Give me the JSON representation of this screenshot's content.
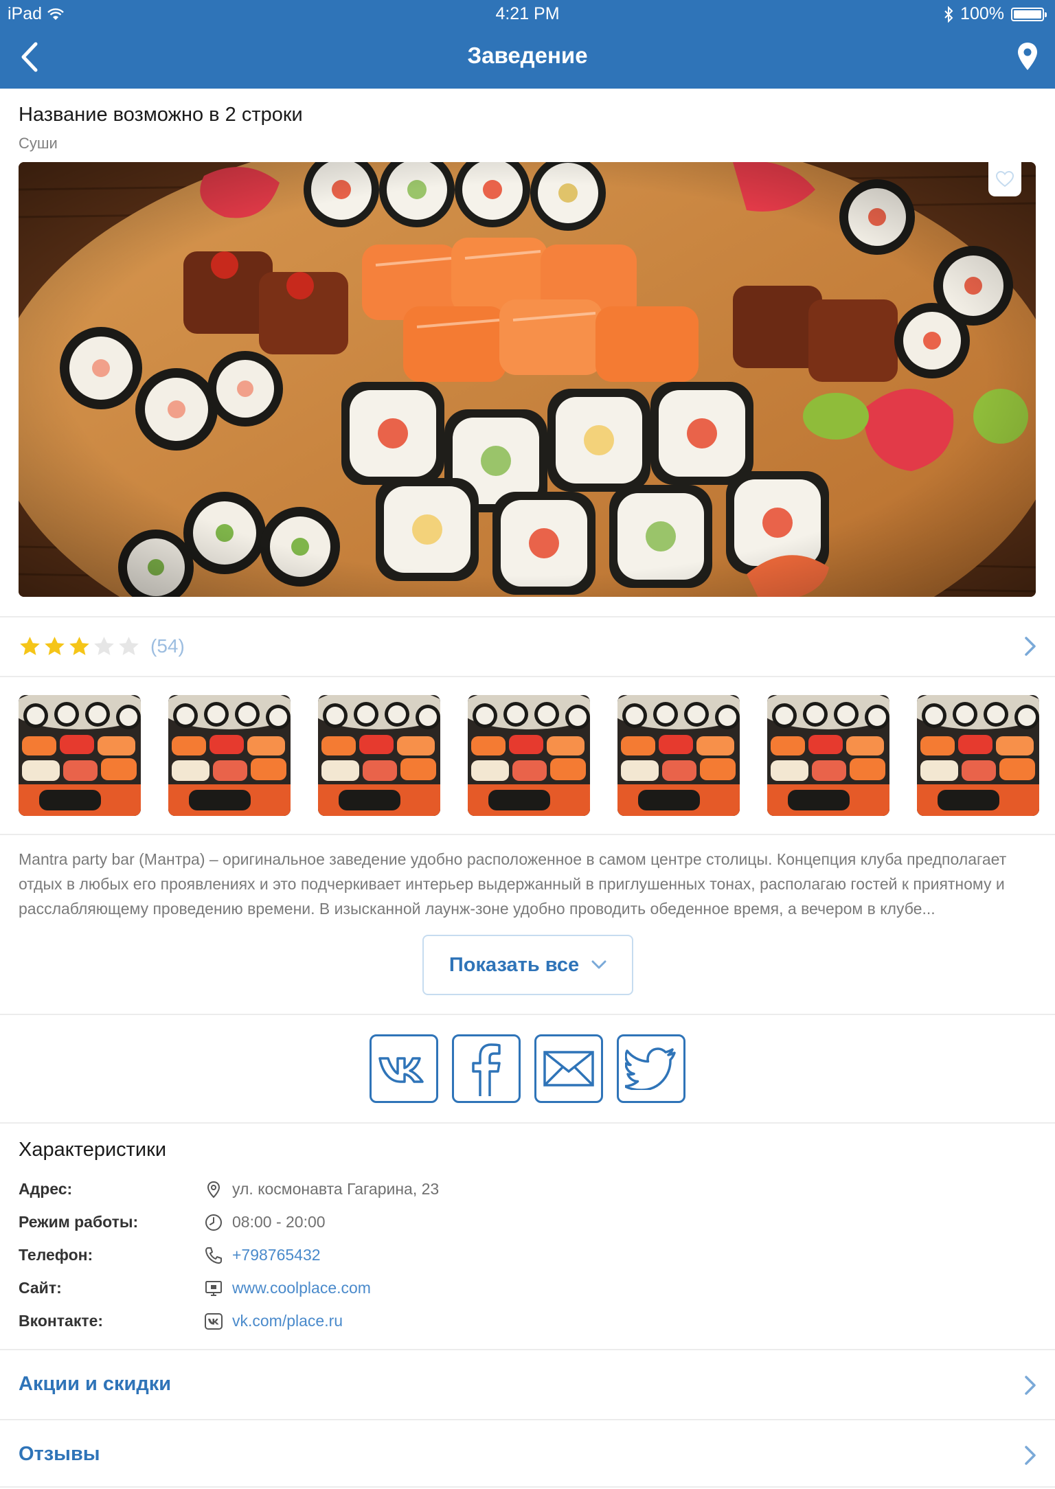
{
  "status_bar": {
    "device": "iPad",
    "time": "4:21 PM",
    "battery": "100%"
  },
  "nav": {
    "title": "Заведение"
  },
  "place": {
    "name": "Название возможно в 2 строки",
    "category": "Суши"
  },
  "rating": {
    "stars": 3,
    "max": 5,
    "count": "(54)"
  },
  "gallery": {
    "thumbnails": [
      "sushi-photo",
      "sushi-photo",
      "sushi-photo",
      "sushi-photo",
      "sushi-photo",
      "sushi-photo",
      "sushi-photo"
    ]
  },
  "description": {
    "text": "Mantra party bar (Мантра) – оригинальное заведение удобно расположенное в самом центре столицы. Концепция клуба предполагает отдых в любых его проявлениях и это подчеркивает интерьер выдержанный в приглушенных тонах, располагаю гостей к приятному и расслабляющему проведению времени. В изысканной лаунж-зоне удобно проводить обеденное время, а вечером в клубе...",
    "show_all_label": "Показать все"
  },
  "social": [
    "vk-icon",
    "facebook-icon",
    "mail-icon",
    "twitter-icon"
  ],
  "characteristics": {
    "title": "Характеристики",
    "rows": [
      {
        "label": "Адрес:",
        "icon": "location-pin-icon",
        "value": "ул. космонавта Гагарина, 23"
      },
      {
        "label": "Режим работы:",
        "icon": "clock-icon",
        "value": "08:00 - 20:00"
      },
      {
        "label": "Телефон:",
        "icon": "phone-icon",
        "value": "+798765432"
      },
      {
        "label": "Сайт:",
        "icon": "monitor-icon",
        "value": "www.coolplace.com"
      },
      {
        "label": "Вконтакте:",
        "icon": "vk-small-icon",
        "value": "vk.com/place.ru"
      }
    ]
  },
  "sections": {
    "promotions": "Акции и скидки",
    "reviews": "Отзывы"
  },
  "colors": {
    "primary": "#2f74b8",
    "star_active": "#f5c518",
    "star_inactive": "#e6e6e6",
    "link": "#4a8acb"
  }
}
